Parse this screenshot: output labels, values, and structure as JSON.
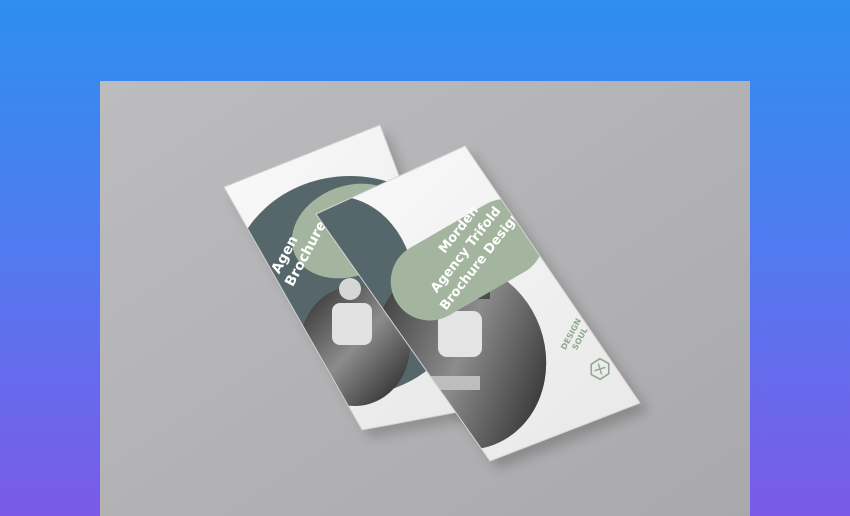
{
  "brochure": {
    "title_line_1": "Morden",
    "title_line_2": "Agency Trifold",
    "title_line_3": "Brochure Design",
    "back_title_line_1": "Agen",
    "back_title_line_2": "Brochure",
    "logo_line_1": "DESIGN",
    "logo_line_2": "SOUL"
  },
  "colors": {
    "page_top": "#2e8ef0",
    "page_bottom": "#7b5ae8",
    "backdrop": "#b4b4b6",
    "paper": "#f2f2f2",
    "sage": "#a3b59f",
    "slate": "#56676b",
    "logo": "#8fa890"
  }
}
